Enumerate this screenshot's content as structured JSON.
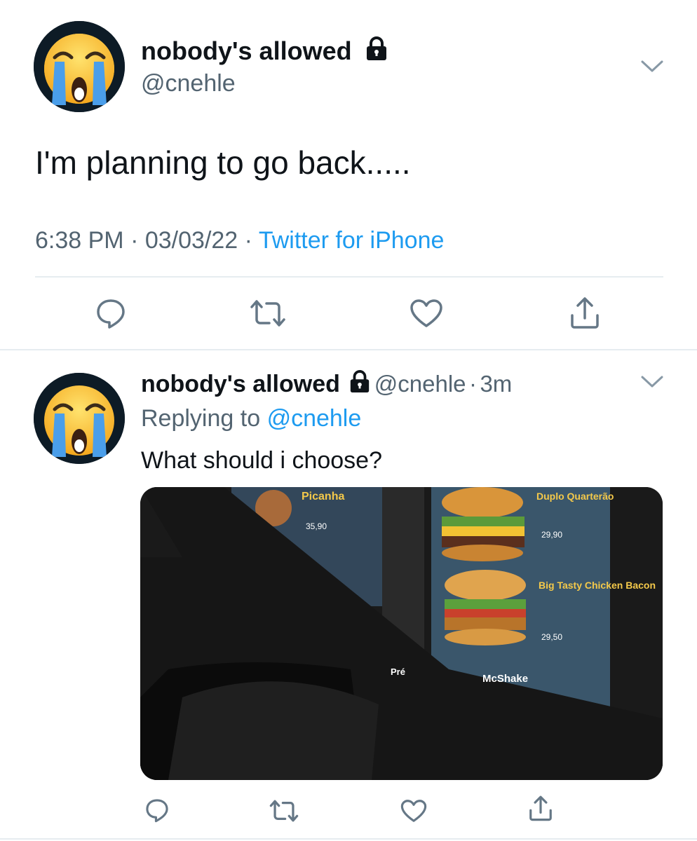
{
  "tweet": {
    "display_name": "nobody's allowed",
    "handle": "@cnehle",
    "text": "I'm planning to go back.....",
    "time": "6:38 PM",
    "separator": "·",
    "date": "03/03/22",
    "client": "Twitter for iPhone",
    "avatar_icon": "loudly-crying-face-emoji",
    "badge_icon": "lock-icon"
  },
  "reply": {
    "display_name": "nobody's allowed",
    "handle": "@cnehle",
    "separator": "·",
    "age": "3m",
    "replying_label": "Replying to",
    "replying_to": "@cnehle",
    "text": "What should i choose?"
  },
  "photo": {
    "menu_items": [
      {
        "name": "Picanha",
        "price": "35,90"
      },
      {
        "name": "Duplo Quarterão",
        "price": "29,90"
      },
      {
        "name": "Big Tasty Chicken Bacon",
        "price": "29,50"
      },
      {
        "name": "McShake",
        "price": ""
      }
    ],
    "pre_label": "Pré"
  },
  "actions": [
    "reply-icon",
    "retweet-icon",
    "like-icon",
    "share-icon"
  ],
  "colors": {
    "link": "#1d9bf0",
    "secondary_text": "#536471",
    "divider": "#e6ecf0"
  }
}
